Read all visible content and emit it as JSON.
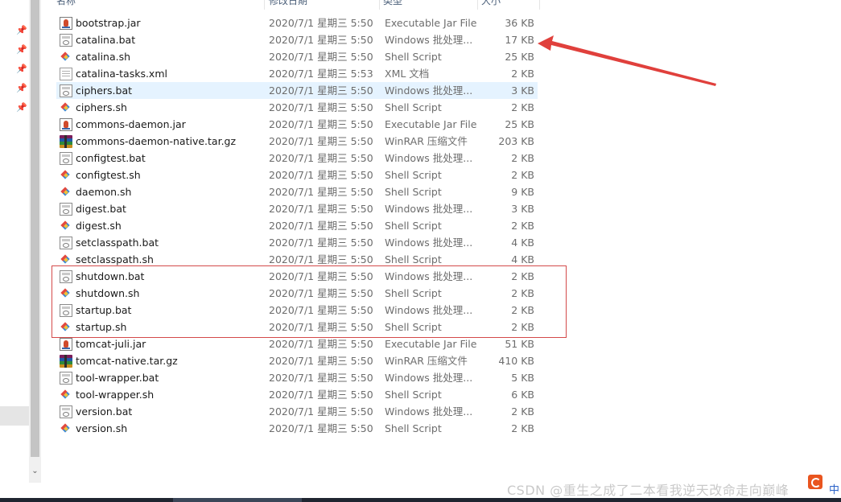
{
  "header": {
    "columns": [
      "名称",
      "修改日期",
      "类型",
      "大小"
    ]
  },
  "files": [
    {
      "name": "bootstrap.jar",
      "date": "2020/7/1 星期三 5:50",
      "type": "Executable Jar File",
      "size": "36 KB",
      "icon": "jar-icon"
    },
    {
      "name": "catalina.bat",
      "date": "2020/7/1 星期三 5:50",
      "type": "Windows 批处理...",
      "size": "17 KB",
      "icon": "bat-icon"
    },
    {
      "name": "catalina.sh",
      "date": "2020/7/1 星期三 5:50",
      "type": "Shell Script",
      "size": "25 KB",
      "icon": "sh-icon"
    },
    {
      "name": "catalina-tasks.xml",
      "date": "2020/7/1 星期三 5:53",
      "type": "XML 文档",
      "size": "2 KB",
      "icon": "xml-icon"
    },
    {
      "name": "ciphers.bat",
      "date": "2020/7/1 星期三 5:50",
      "type": "Windows 批处理...",
      "size": "3 KB",
      "icon": "bat-icon",
      "selected": true
    },
    {
      "name": "ciphers.sh",
      "date": "2020/7/1 星期三 5:50",
      "type": "Shell Script",
      "size": "2 KB",
      "icon": "sh-icon"
    },
    {
      "name": "commons-daemon.jar",
      "date": "2020/7/1 星期三 5:50",
      "type": "Executable Jar File",
      "size": "25 KB",
      "icon": "jar-icon"
    },
    {
      "name": "commons-daemon-native.tar.gz",
      "date": "2020/7/1 星期三 5:50",
      "type": "WinRAR 压缩文件",
      "size": "203 KB",
      "icon": "rar-icon"
    },
    {
      "name": "configtest.bat",
      "date": "2020/7/1 星期三 5:50",
      "type": "Windows 批处理...",
      "size": "2 KB",
      "icon": "bat-icon"
    },
    {
      "name": "configtest.sh",
      "date": "2020/7/1 星期三 5:50",
      "type": "Shell Script",
      "size": "2 KB",
      "icon": "sh-icon"
    },
    {
      "name": "daemon.sh",
      "date": "2020/7/1 星期三 5:50",
      "type": "Shell Script",
      "size": "9 KB",
      "icon": "sh-icon"
    },
    {
      "name": "digest.bat",
      "date": "2020/7/1 星期三 5:50",
      "type": "Windows 批处理...",
      "size": "3 KB",
      "icon": "bat-icon"
    },
    {
      "name": "digest.sh",
      "date": "2020/7/1 星期三 5:50",
      "type": "Shell Script",
      "size": "2 KB",
      "icon": "sh-icon"
    },
    {
      "name": "setclasspath.bat",
      "date": "2020/7/1 星期三 5:50",
      "type": "Windows 批处理...",
      "size": "4 KB",
      "icon": "bat-icon"
    },
    {
      "name": "setclasspath.sh",
      "date": "2020/7/1 星期三 5:50",
      "type": "Shell Script",
      "size": "4 KB",
      "icon": "sh-icon"
    },
    {
      "name": "shutdown.bat",
      "date": "2020/7/1 星期三 5:50",
      "type": "Windows 批处理...",
      "size": "2 KB",
      "icon": "bat-icon"
    },
    {
      "name": "shutdown.sh",
      "date": "2020/7/1 星期三 5:50",
      "type": "Shell Script",
      "size": "2 KB",
      "icon": "sh-icon"
    },
    {
      "name": "startup.bat",
      "date": "2020/7/1 星期三 5:50",
      "type": "Windows 批处理...",
      "size": "2 KB",
      "icon": "bat-icon"
    },
    {
      "name": "startup.sh",
      "date": "2020/7/1 星期三 5:50",
      "type": "Shell Script",
      "size": "2 KB",
      "icon": "sh-icon"
    },
    {
      "name": "tomcat-juli.jar",
      "date": "2020/7/1 星期三 5:50",
      "type": "Executable Jar File",
      "size": "51 KB",
      "icon": "jar-icon"
    },
    {
      "name": "tomcat-native.tar.gz",
      "date": "2020/7/1 星期三 5:50",
      "type": "WinRAR 压缩文件",
      "size": "410 KB",
      "icon": "rar-icon"
    },
    {
      "name": "tool-wrapper.bat",
      "date": "2020/7/1 星期三 5:50",
      "type": "Windows 批处理...",
      "size": "5 KB",
      "icon": "bat-icon"
    },
    {
      "name": "tool-wrapper.sh",
      "date": "2020/7/1 星期三 5:50",
      "type": "Shell Script",
      "size": "6 KB",
      "icon": "sh-icon"
    },
    {
      "name": "version.bat",
      "date": "2020/7/1 星期三 5:50",
      "type": "Windows 批处理...",
      "size": "2 KB",
      "icon": "bat-icon"
    },
    {
      "name": "version.sh",
      "date": "2020/7/1 星期三 5:50",
      "type": "Shell Script",
      "size": "2 KB",
      "icon": "sh-icon"
    }
  ],
  "watermark": "CSDN @重生之成了二本看我逆天改命走向巅峰",
  "ime_indicator": "中",
  "colors": {
    "annotation_red": "#d44a4a",
    "selection_bg": "#e5f3ff"
  }
}
